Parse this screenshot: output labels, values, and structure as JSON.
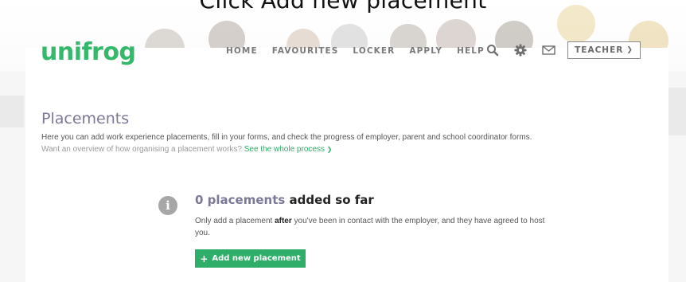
{
  "caption": "Click Add new placement",
  "header": {
    "logo": "unifrog",
    "nav": [
      "HOME",
      "FAVOURITES",
      "LOCKER",
      "APPLY",
      "HELP"
    ],
    "icons": [
      "search-icon",
      "gear-icon",
      "mail-icon"
    ],
    "account_label": "TEACHER",
    "account_chevron": "❯"
  },
  "page": {
    "title": "Placements",
    "intro": "Here you can add work experience placements, fill in your forms, and check the progress of employer, parent and school coordinator forms.",
    "overview_prefix": "Want an overview of how organising a placement works?",
    "overview_link": "See the whole process",
    "overview_chevron": "❯"
  },
  "summary": {
    "count": "0 placements",
    "count_suffix": "added so far",
    "note_before": "Only add a placement",
    "note_bold": "after",
    "note_after": "you've been in contact with the employer, and they have agreed to host you.",
    "button_icon": "+",
    "button_label": "Add new placement"
  },
  "colors": {
    "brand": "#34b86a",
    "accent": "#2eae68",
    "title": "#7b7898"
  }
}
